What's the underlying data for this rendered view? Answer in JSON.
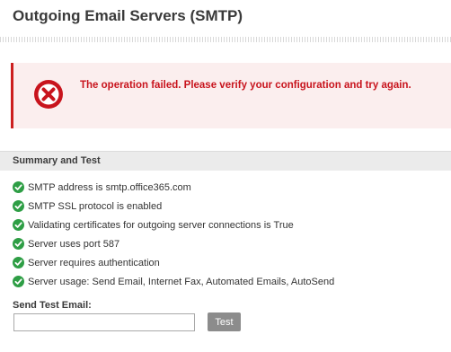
{
  "page": {
    "title": "Outgoing Email Servers (SMTP)"
  },
  "alert": {
    "message": "The operation failed. Please verify your configuration and try again.",
    "icon": "error-x-icon",
    "color": "#c8141d",
    "background": "#fbeeee"
  },
  "summary": {
    "header": "Summary and Test",
    "check_icon": "check-circle-icon",
    "check_color": "#2e9e45",
    "items": [
      {
        "text": "SMTP address is smtp.office365.com"
      },
      {
        "text": "SMTP SSL protocol is enabled"
      },
      {
        "text": "Validating certificates for outgoing server connections is True"
      },
      {
        "text": "Server uses port 587"
      },
      {
        "text": "Server requires authentication"
      },
      {
        "text": "Server usage: Send Email, Internet Fax, Automated Emails, AutoSend"
      }
    ]
  },
  "test_email": {
    "label": "Send Test Email:",
    "value": "",
    "placeholder": "",
    "button_label": "Test"
  }
}
